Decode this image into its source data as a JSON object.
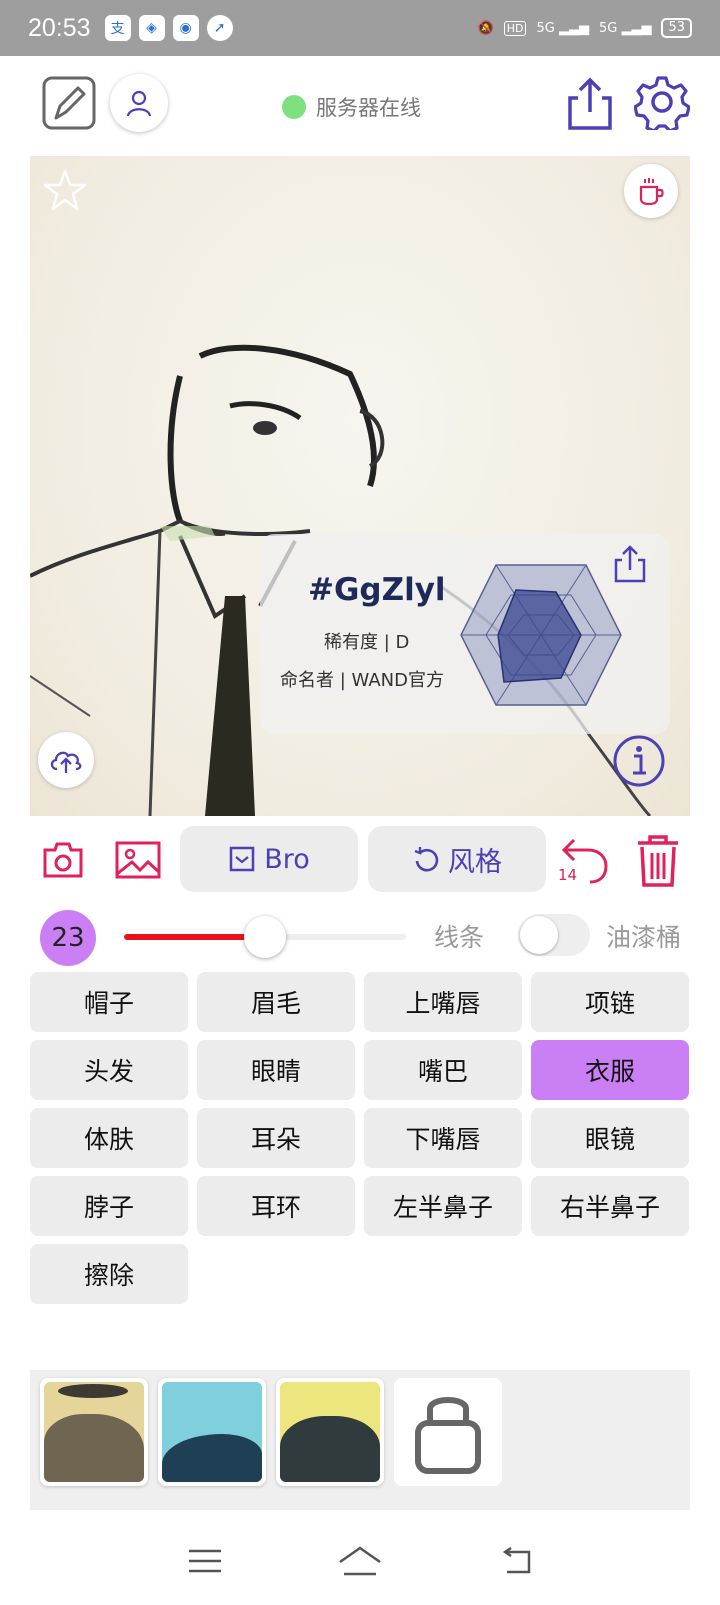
{
  "status_bar": {
    "time": "20:53",
    "network_a": "5G",
    "network_b": "5G",
    "hd": "HD",
    "battery": "53"
  },
  "header": {
    "server_status": "服务器在线",
    "server_status_color": "#7ee07e",
    "icons": [
      "edit-icon",
      "user-icon",
      "share-icon",
      "settings-icon"
    ]
  },
  "canvas": {
    "card": {
      "code": "#GgZlyl",
      "rarity": "稀有度 | D",
      "namer": "命名者 | WAND官方"
    }
  },
  "toolbar": {
    "bro_label": "Bro",
    "style_label": "风格",
    "undo_count": "14"
  },
  "brush": {
    "size": "23",
    "size_fraction": 0.5,
    "line_label": "线条",
    "bucket_label": "油漆桶",
    "bucket_enabled": false
  },
  "categories": [
    "帽子",
    "眉毛",
    "上嘴唇",
    "项链",
    "头发",
    "眼睛",
    "嘴巴",
    "衣服",
    "体肤",
    "耳朵",
    "下嘴唇",
    "眼镜",
    "脖子",
    "耳环",
    "左半鼻子",
    "右半鼻子",
    "擦除"
  ],
  "selected_category": "衣服",
  "accent_color": "#cb7ff5",
  "brand_color": "#4d3fb5",
  "danger_color": "#e0215e"
}
